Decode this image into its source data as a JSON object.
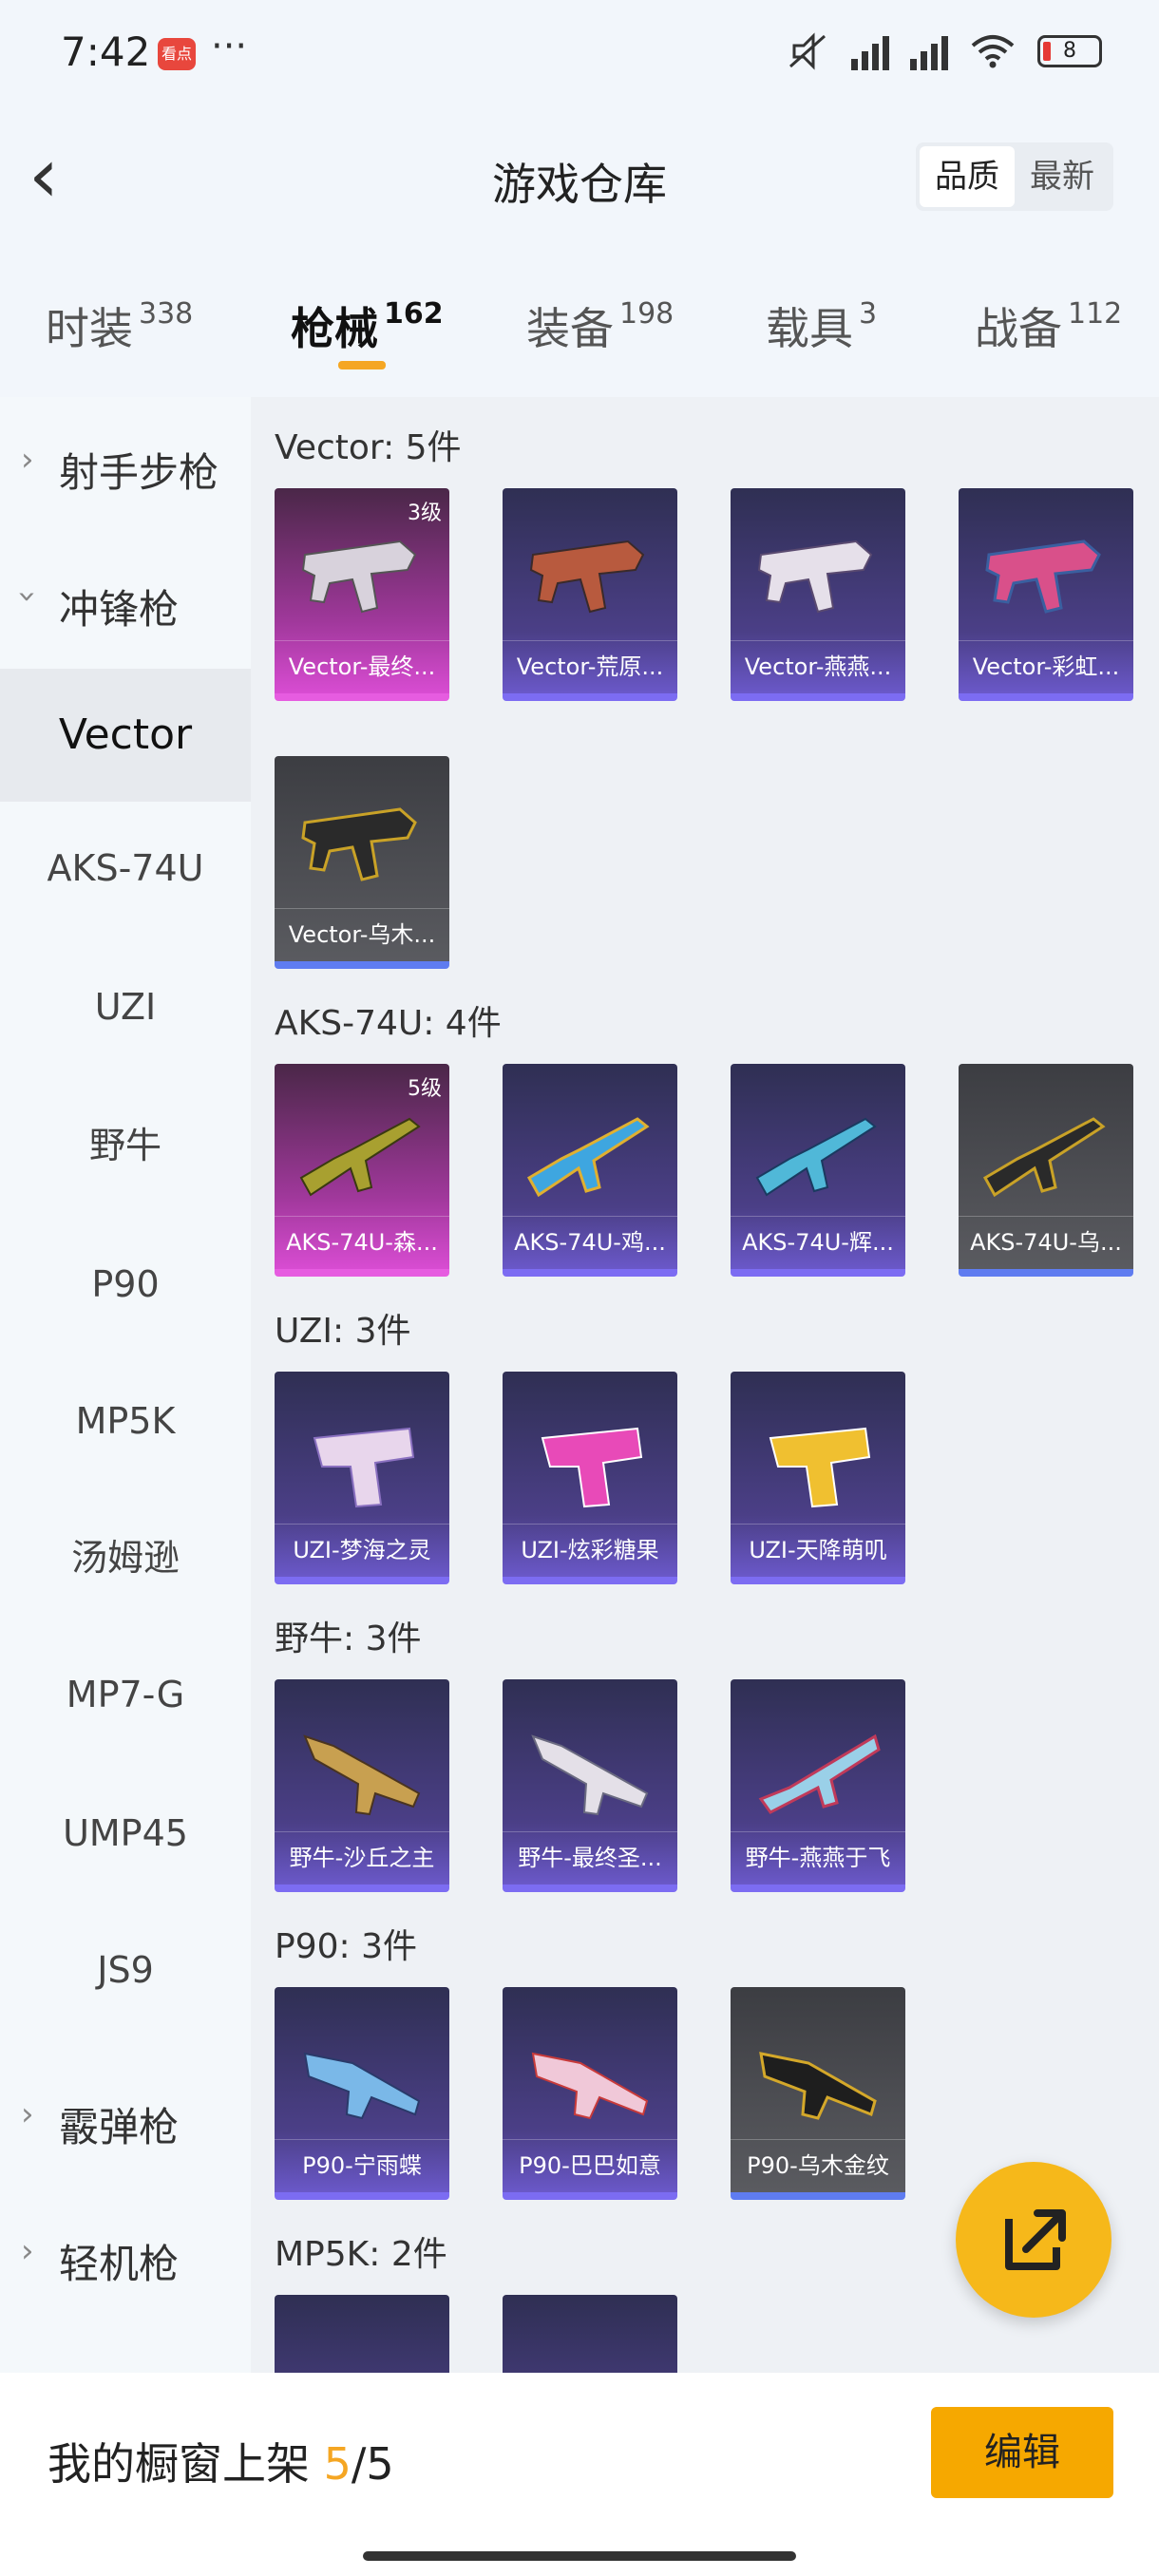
{
  "status": {
    "time": "7:42",
    "app_badge": "看点",
    "more": "···",
    "battery": "8"
  },
  "header": {
    "title": "游戏仓库",
    "sort_quality": "品质",
    "sort_latest": "最新"
  },
  "tabs": [
    {
      "label": "时装",
      "count": "338"
    },
    {
      "label": "枪械",
      "count": "162"
    },
    {
      "label": "装备",
      "count": "198"
    },
    {
      "label": "载具",
      "count": "3"
    },
    {
      "label": "战备",
      "count": "112"
    }
  ],
  "sidebar": {
    "groups": [
      "射手步枪",
      "冲锋枪",
      "霰弹枪",
      "轻机枪"
    ],
    "items": [
      "Vector",
      "AKS-74U",
      "UZI",
      "野牛",
      "P90",
      "MP5K",
      "汤姆逊",
      "MP7-G",
      "UMP45",
      "JS9"
    ]
  },
  "sections": [
    {
      "title": "Vector: 5件",
      "cards": [
        "Vector-最终...",
        "Vector-荒原...",
        "Vector-燕燕...",
        "Vector-彩虹...",
        "Vector-乌木..."
      ],
      "levels": [
        "3级"
      ]
    },
    {
      "title": "AKS-74U: 4件",
      "cards": [
        "AKS-74U-森...",
        "AKS-74U-鸡...",
        "AKS-74U-辉...",
        "AKS-74U-乌..."
      ],
      "levels": [
        "5级"
      ]
    },
    {
      "title": "UZI: 3件",
      "cards": [
        "UZI-梦海之灵",
        "UZI-炫彩糖果",
        "UZI-天降萌叽"
      ]
    },
    {
      "title": "野牛: 3件",
      "cards": [
        "野牛-沙丘之主",
        "野牛-最终圣...",
        "野牛-燕燕于飞"
      ]
    },
    {
      "title": "P90: 3件",
      "cards": [
        "P90-宁雨蝶",
        "P90-巴巴如意",
        "P90-乌木金纹"
      ]
    },
    {
      "title": "MP5K: 2件"
    }
  ],
  "bottom": {
    "label": "我的橱窗上架",
    "current": "5",
    "sep": "/",
    "total": "5",
    "edit": "编辑"
  },
  "colors": {
    "accent": "#f6a800",
    "purple_rarity": "#7c6cf2",
    "pink_rarity": "#e65ce0"
  }
}
